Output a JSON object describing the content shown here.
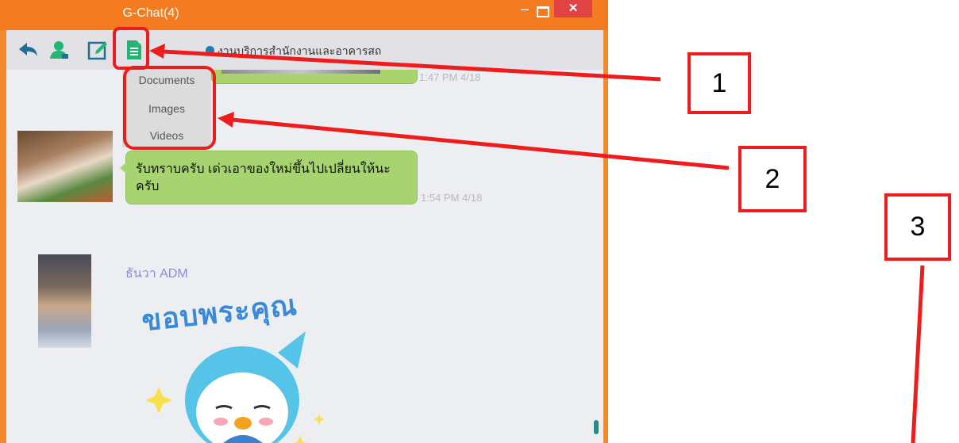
{
  "window": {
    "title": "G-Chat(4)",
    "min_glyph": "–",
    "close_glyph": "✕"
  },
  "toolbar": {
    "icons": [
      "back-arrow-icon",
      "contacts-person-icon",
      "edit-pencil-icon",
      "document-file-icon"
    ],
    "room_name": "งานบริการสำนักงานและอาคารสถ"
  },
  "attach_menu": {
    "items": [
      "Documents",
      "Images",
      "Videos"
    ]
  },
  "messages": {
    "prev_time": "1:47 PM 4/18",
    "msg1_text": "รับทราบครับ เด่วเอาของใหม่ขึ้นไปเปลี่ยนให้นะครับ",
    "msg1_time": "1:54 PM 4/18",
    "sender_name": "ธันวา ADM",
    "sticker_text": "ขอบพระคุณ"
  },
  "annotations": {
    "callout1": "1",
    "callout2": "2",
    "callout3": "3",
    "color": "#ee1c1c"
  },
  "colors": {
    "titlebar": "#f47b20",
    "bubble": "#a7d470",
    "accent_green": "#22b573"
  }
}
